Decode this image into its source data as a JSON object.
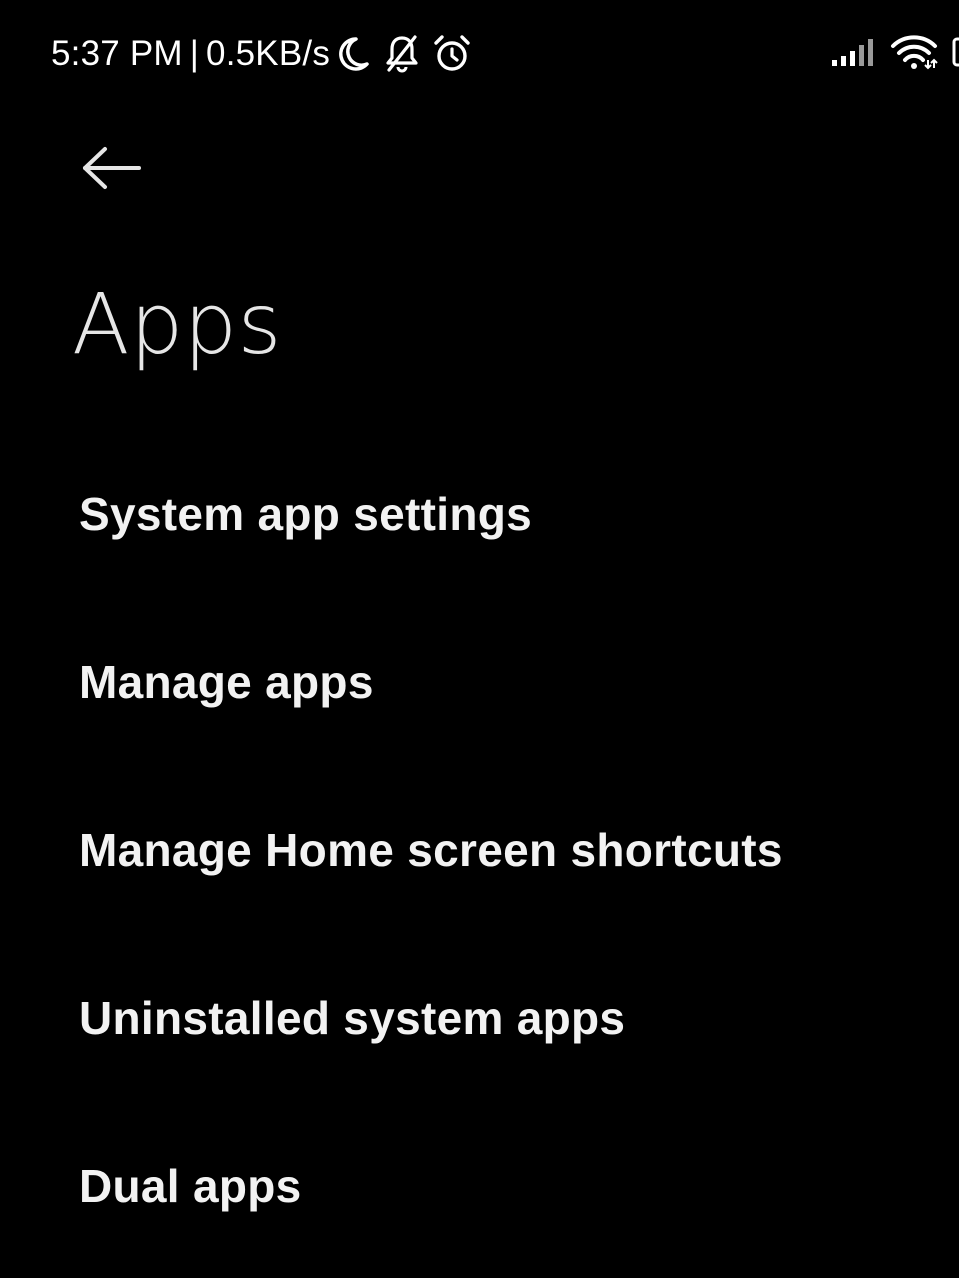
{
  "status_bar": {
    "time": "5:37 PM",
    "separator": "|",
    "network_speed": "0.5KB/s",
    "icons": [
      "moon-icon",
      "bell-off-icon",
      "alarm-icon",
      "signal-icon",
      "wifi-icon",
      "battery-icon"
    ]
  },
  "header": {
    "back_icon": "arrow-left-icon",
    "title": "Apps"
  },
  "menu": {
    "items": [
      {
        "label": "System app settings"
      },
      {
        "label": "Manage apps"
      },
      {
        "label": "Manage Home screen shortcuts"
      },
      {
        "label": "Uninstalled system apps"
      },
      {
        "label": "Dual apps"
      }
    ]
  },
  "colors": {
    "background": "#000000",
    "title_text": "#e6e6e6",
    "item_text": "#f2f2f2",
    "status_text": "#ffffff"
  }
}
